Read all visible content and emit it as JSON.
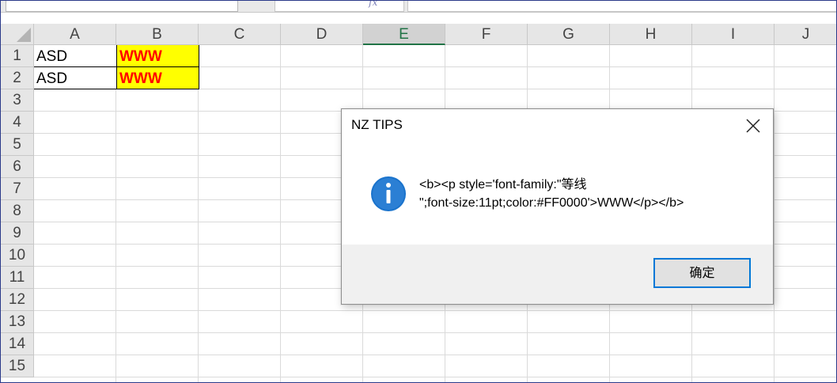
{
  "formula_bar": {
    "fx_label": "fx"
  },
  "spreadsheet": {
    "columns": [
      "A",
      "B",
      "C",
      "D",
      "E",
      "F",
      "G",
      "H",
      "I",
      "J"
    ],
    "active_column": "E",
    "rows": [
      "1",
      "2",
      "3",
      "4",
      "5",
      "6",
      "7",
      "8",
      "9",
      "10",
      "11",
      "12",
      "13",
      "14",
      "15"
    ],
    "cells": {
      "A1": "ASD",
      "B1": "WWW",
      "A2": "ASD",
      "B2": "WWW"
    },
    "colors": {
      "b_fill": "#ffff00",
      "b_text": "#ff0000",
      "active_header": "#217346"
    }
  },
  "dialog": {
    "title": "NZ TIPS",
    "icon": "info-icon",
    "message": "<b><p style='font-family:\"等线\n\";font-size:11pt;color:#FF0000'>WWW</p></b>",
    "ok_label": "确定",
    "accent": "#0078d7"
  }
}
